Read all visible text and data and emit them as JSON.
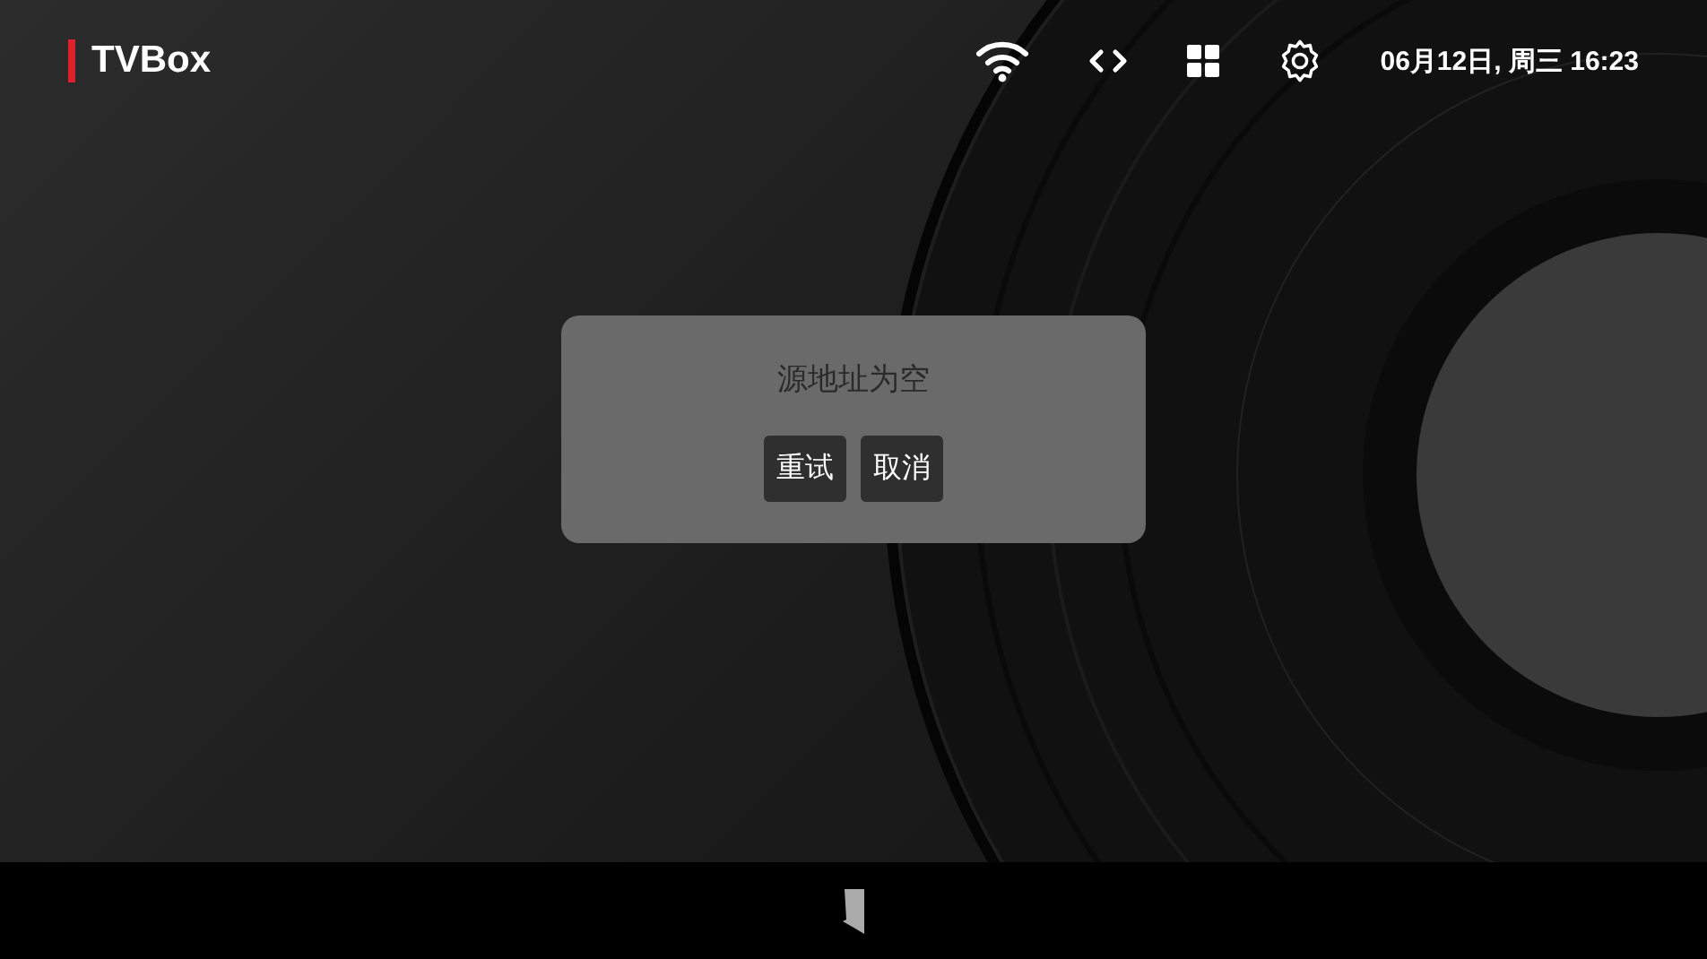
{
  "header": {
    "title": "TVBox",
    "datetime": "06月12日, 周三 16:23"
  },
  "dialog": {
    "message": "源地址为空",
    "buttons": [
      "重试",
      "取消"
    ]
  }
}
